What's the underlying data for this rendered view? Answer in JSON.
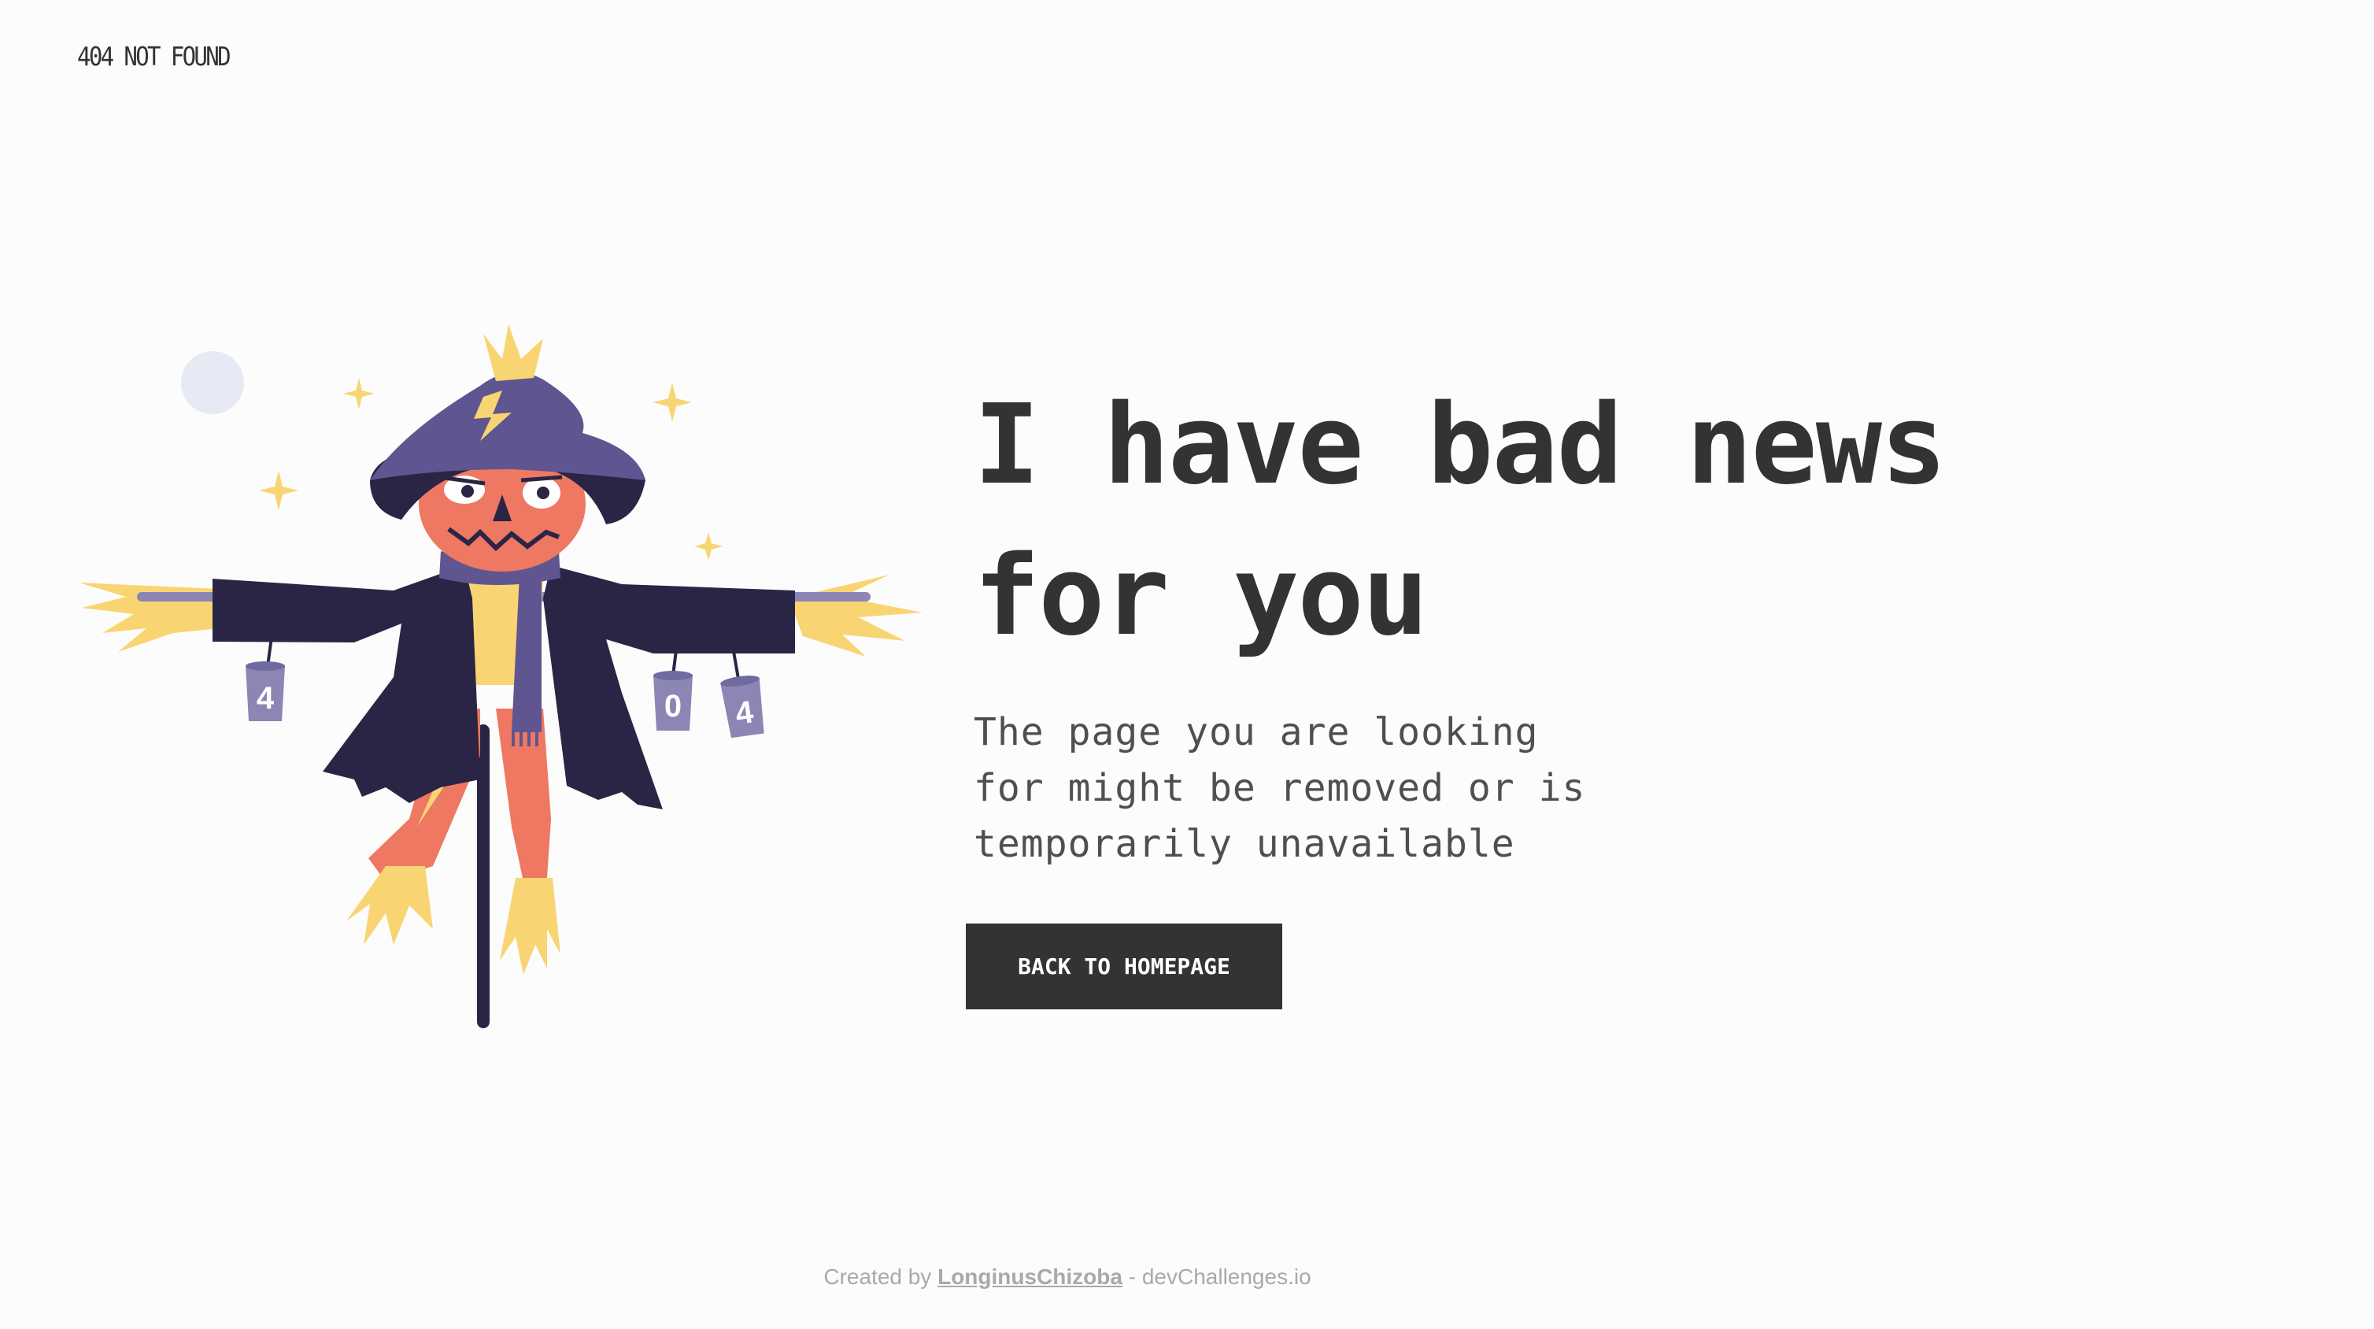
{
  "header": {
    "brand": "404 NOT FOUND"
  },
  "main": {
    "headline_line1": "I have bad news",
    "headline_line2": "for you",
    "message_line1": "The page you are looking",
    "message_line2": "for might be removed or is",
    "message_line3": "temporarily unavailable",
    "button_label": "BACK TO HOMEPAGE"
  },
  "illustration": {
    "can_labels": [
      "4",
      "0",
      "4"
    ]
  },
  "footer": {
    "prefix": "Created by",
    "author": "LonginusChizoba",
    "suffix": "- devChallenges.io"
  },
  "colors": {
    "background": "#fcfcfc",
    "text": "#333333",
    "button_bg": "#333333",
    "button_text": "#ffffff",
    "coat": "#2a2545",
    "hat": "#5f5590",
    "face": "#ee7861",
    "straw": "#f8d572",
    "can": "#8b86b4"
  }
}
